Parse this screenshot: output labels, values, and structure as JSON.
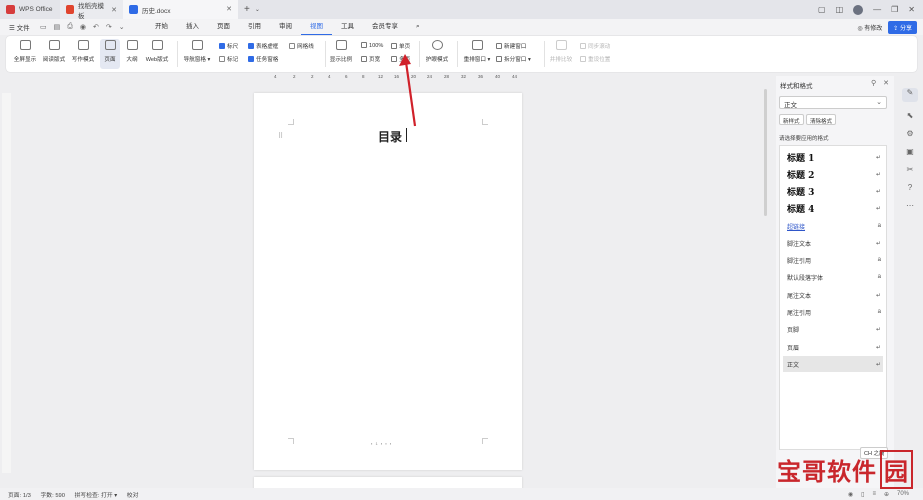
{
  "titlebar": {
    "tabs": [
      {
        "label": "WPS Office",
        "icon": "wps-logo-icon"
      },
      {
        "label": "找稻壳模板",
        "icon": "docer-icon"
      },
      {
        "label": "历史.docx",
        "icon": "word-doc-icon"
      }
    ]
  },
  "menubar": {
    "file_label": "文件",
    "items": [
      "开始",
      "插入",
      "页面",
      "引用",
      "审阅",
      "视图",
      "工具",
      "会员专享"
    ],
    "active": "视图",
    "right": {
      "user_label": "有修改",
      "share_label": "分享"
    }
  },
  "ribbon": {
    "fullscreen": "全屏显示",
    "reading": "阅读版式",
    "writing": "写作模式",
    "page": "页面",
    "outline": "大纲",
    "web": "Web版式",
    "nav_pane": "导航窗格",
    "ruler": "标尺",
    "marks": "标记",
    "table_grid": "表格虚框",
    "task_pane": "任务窗格",
    "gridlines": "网格线",
    "zoom_ratio": "显示比例",
    "zoom_100": "100%",
    "page_width": "页宽",
    "single_page": "单页",
    "multi_page": "多页",
    "eye_mode": "护眼模式",
    "rearrange": "重排窗口",
    "new_window": "新建窗口",
    "split_window": "拆分窗口",
    "sync_scroll": "同步滚动",
    "side_by_side": "并排比较",
    "reset_position": "重设位置"
  },
  "ruler_ticks": [
    "4",
    "2",
    "2",
    "4",
    "6",
    "8",
    "12",
    "16",
    "20",
    "24",
    "28",
    "32",
    "36",
    "40",
    "44"
  ],
  "document": {
    "title": "目录",
    "footer_mark": "▪ 1 ▪ ▪ ▪"
  },
  "style_panel": {
    "title": "样式和格式",
    "current_style": "正文",
    "new_style": "新样式",
    "clear_format": "清除格式",
    "prompt": "请选择要应用的格式",
    "styles": [
      {
        "name": "标题 1",
        "kind": "heading",
        "mark": "↵"
      },
      {
        "name": "标题 2",
        "kind": "heading",
        "mark": "↵"
      },
      {
        "name": "标题 3",
        "kind": "heading",
        "mark": "↵"
      },
      {
        "name": "标题 4",
        "kind": "heading",
        "mark": "↵"
      },
      {
        "name": "超链接",
        "kind": "link",
        "mark": "a"
      },
      {
        "name": "脚注文本",
        "kind": "normal",
        "mark": "↵"
      },
      {
        "name": "脚注引用",
        "kind": "normal",
        "mark": "a"
      },
      {
        "name": "默认段落字体",
        "kind": "normal",
        "mark": "a"
      },
      {
        "name": "尾注文本",
        "kind": "normal",
        "mark": "↵"
      },
      {
        "name": "尾注引用",
        "kind": "normal",
        "mark": "a"
      },
      {
        "name": "页脚",
        "kind": "normal",
        "mark": "↵"
      },
      {
        "name": "页眉",
        "kind": "normal",
        "mark": "↵"
      },
      {
        "name": "正文",
        "kind": "normal",
        "mark": "↵",
        "selected": true
      }
    ],
    "bottom_label": "CH 之简"
  },
  "statusbar": {
    "page": "页面: 1/3",
    "words": "字数: 590",
    "spell": "拼写检查: 打开 ▾",
    "proof": "校对",
    "zoom": "70%"
  },
  "watermark": {
    "text": "宝哥软件",
    "boxed": "园"
  },
  "colors": {
    "accent": "#2f6be6",
    "annotation": "#d0212a",
    "watermark": "#c6161b"
  }
}
